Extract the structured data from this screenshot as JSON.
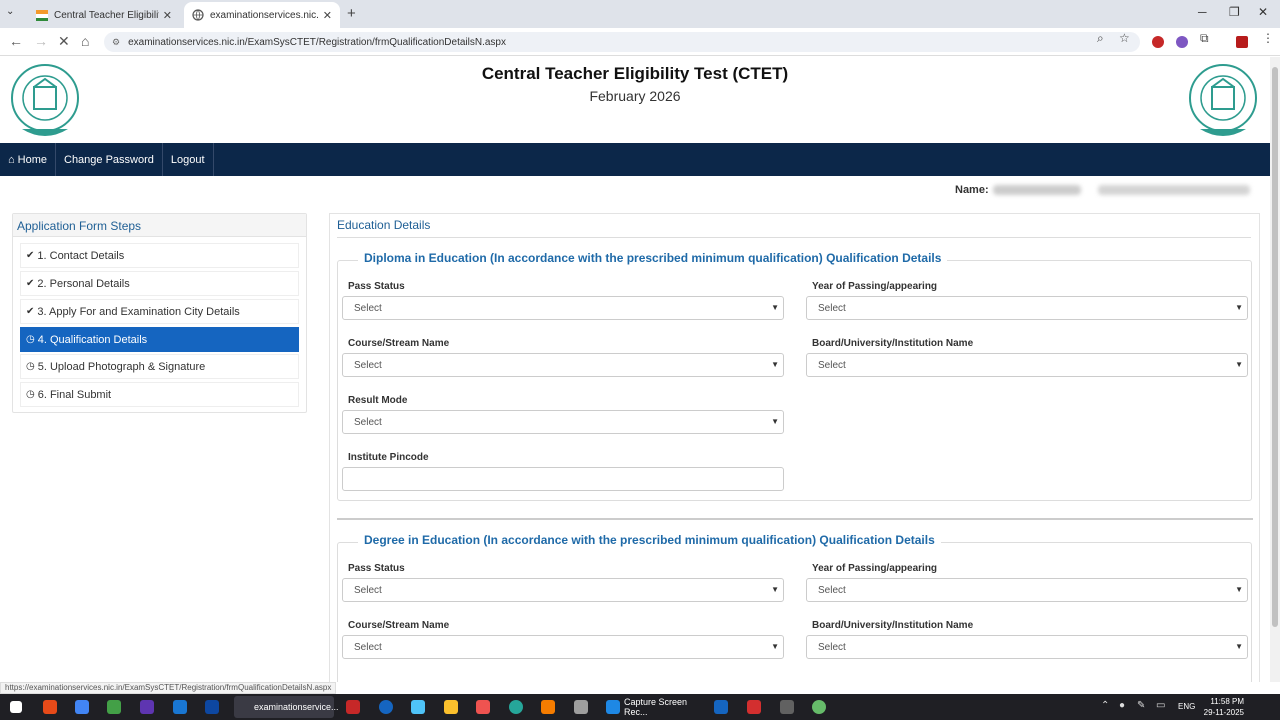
{
  "browser": {
    "tabs": [
      {
        "title": "Central Teacher Eligibility Test | ",
        "active": false
      },
      {
        "title": "examinationservices.nic.in/Exam",
        "active": true
      }
    ],
    "url": "examinationservices.nic.in/ExamSysCTET/Registration/frmQualificationDetailsN.aspx",
    "status_url": "https://examinationservices.nic.in/ExamSysCTET/Registration/frmQualificationDetailsN.aspx"
  },
  "header": {
    "title": "Central Teacher Eligibility Test (CTET)",
    "subtitle": "February 2026"
  },
  "nav": {
    "home": "Home",
    "change_password": "Change Password",
    "logout": "Logout"
  },
  "candidate": {
    "name_label": "Name:"
  },
  "steps": {
    "title": "Application Form Steps",
    "items": [
      {
        "label": "1. Contact Details",
        "done": true
      },
      {
        "label": "2. Personal Details",
        "done": true
      },
      {
        "label": "3. Apply For and Examination City Details",
        "done": true
      },
      {
        "label": "4. Qualification Details",
        "done": false,
        "active": true
      },
      {
        "label": "5. Upload Photograph & Signature",
        "done": false
      },
      {
        "label": "6. Final Submit",
        "done": false
      }
    ]
  },
  "education": {
    "title": "Education Details",
    "diploma": {
      "legend": "Diploma in Education (In accordance with the prescribed minimum qualification) Qualification Details",
      "pass_status": {
        "label": "Pass Status",
        "value": "Select"
      },
      "year": {
        "label": "Year of Passing/appearing",
        "value": "Select"
      },
      "course": {
        "label": "Course/Stream Name",
        "value": "Select"
      },
      "board": {
        "label": "Board/University/Institution Name",
        "value": "Select"
      },
      "result_mode": {
        "label": "Result Mode",
        "value": "Select"
      },
      "pincode": {
        "label": "Institute Pincode",
        "value": ""
      }
    },
    "degree": {
      "legend": "Degree in Education (In accordance with the prescribed minimum qualification) Qualification Details",
      "pass_status": {
        "label": "Pass Status",
        "value": "Select"
      },
      "year": {
        "label": "Year of Passing/appearing",
        "value": "Select"
      },
      "course": {
        "label": "Course/Stream Name",
        "value": "Select"
      },
      "board": {
        "label": "Board/University/Institution Name",
        "value": "Select"
      }
    }
  },
  "taskbar": {
    "examination_label": "examinationservice...",
    "capture_label": "Capture Screen Rec...",
    "lang": "ENG",
    "time": "11:58 PM",
    "date": "29-11-2025"
  },
  "colors": {
    "navbar": "#0c2749",
    "accent": "#1565c0",
    "heading": "#1f5f95"
  }
}
